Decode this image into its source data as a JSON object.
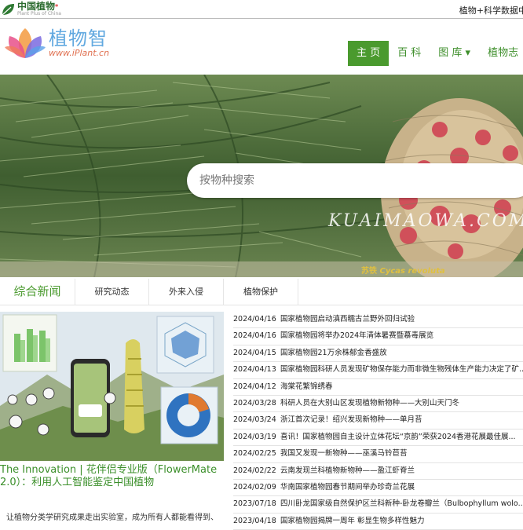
{
  "topbar": {
    "logo_title": "中国植物",
    "logo_star": "*",
    "logo_sub": "Plant Plus of China",
    "right_text": "植物+科学数据中心"
  },
  "header": {
    "brand_name": "植物智",
    "brand_url": "www.iPlant.cn",
    "nav": [
      {
        "label": "主 页",
        "active": true
      },
      {
        "label": "百 科"
      },
      {
        "label": "图 库 ▾"
      },
      {
        "label": "植物志"
      }
    ]
  },
  "hero": {
    "search_placeholder": "按物种搜索",
    "watermark": "KUAIMAOWA.COM",
    "caption_cn": "苏铁",
    "caption_latin": "Cycas revoluta"
  },
  "tabs": [
    "综合新闻",
    "研究动态",
    "外来入侵",
    "植物保护"
  ],
  "feature": {
    "title": "The Innovation | 花伴侣专业版（FlowerMate 2.0）：利用人工智能鉴定中国植物",
    "desc": "让植物分类学研究成果走出实验室，成为所有人都能看得到、"
  },
  "news": [
    {
      "date": "2024/04/16",
      "title": "国家植物园启动滇西糯古兰野外回归试验"
    },
    {
      "date": "2024/04/16",
      "title": "国家植物园将举办2024年清体暑赛暨慕毒展览"
    },
    {
      "date": "2024/04/15",
      "title": "国家植物园21万余株郁金香盛放"
    },
    {
      "date": "2024/04/13",
      "title": "国家植物园科研人员发现矿物保存能力而非微生物残体生产能力决定了矿..."
    },
    {
      "date": "2024/04/12",
      "title": "海棠花繁锦绣春"
    },
    {
      "date": "2024/03/28",
      "title": "科研人员在大别山区发现植物新物种——大别山天门冬"
    },
    {
      "date": "2024/03/24",
      "title": "浙江首次记录！绍兴发现新物种——单月苔"
    },
    {
      "date": "2024/03/19",
      "title": "喜讯！国家植物园自主设计立体花坛“京韵”荣获2024香港花展最佳展..."
    },
    {
      "date": "2024/02/25",
      "title": "我国又发现一新物种——巫溪马铃苣苔"
    },
    {
      "date": "2024/02/22",
      "title": "云南发现兰科植物新物种——盈江虾脊兰"
    },
    {
      "date": "2024/02/09",
      "title": "华南国家植物园春节期间举办珍奇兰花展"
    },
    {
      "date": "2023/07/18",
      "title": "四川卧龙国家级自然保护区兰科新种-卧龙卷瓣兰（Bulbophyllum wolo..."
    },
    {
      "date": "2023/04/18",
      "title": "国家植物园揭牌一周年 彰显生物多样性魅力"
    }
  ]
}
